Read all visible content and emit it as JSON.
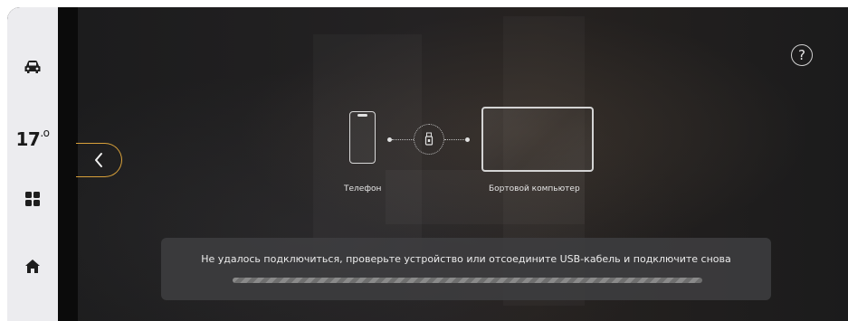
{
  "sidebar": {
    "items": [
      {
        "icon": "car-icon"
      },
      {
        "temperature": "17",
        "unit": ".o"
      },
      {
        "icon": "apps-grid-icon"
      },
      {
        "icon": "home-icon"
      }
    ]
  },
  "header": {
    "help_label": "?"
  },
  "diagram": {
    "phone_label": "Телефон",
    "computer_label": "Бортовой компьютер",
    "connector_icon": "usb-icon"
  },
  "status": {
    "message": "Не удалось подключиться, проверьте устройство или отсоедините USB-кабель и подключите снова",
    "progress_state": "indeterminate"
  },
  "colors": {
    "accent": "#d8a03a",
    "sidebar_bg": "#ececef",
    "screen_bg": "#1a1a1b",
    "message_bg": "#3e3e40"
  }
}
